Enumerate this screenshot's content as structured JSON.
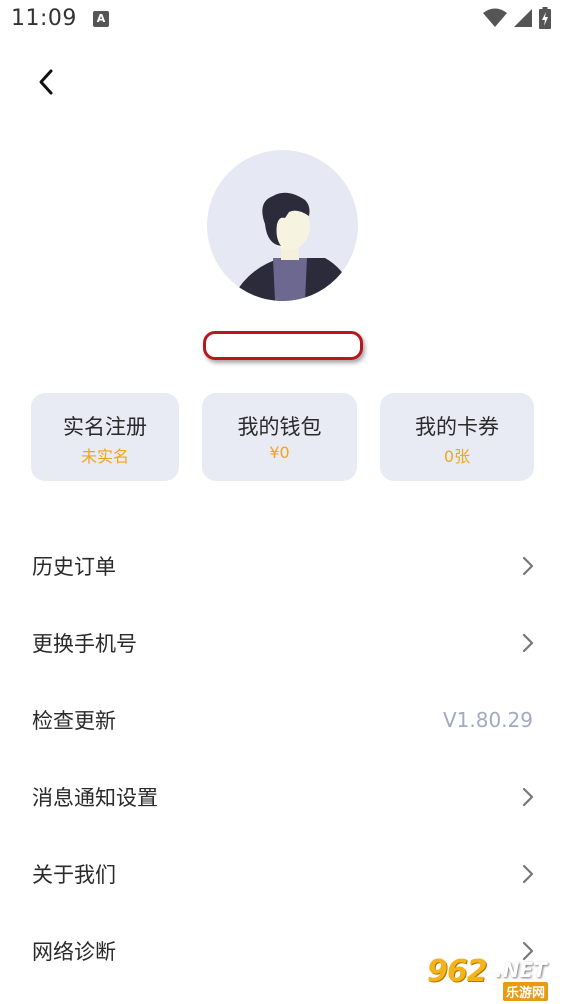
{
  "status_bar": {
    "time": "11:09",
    "notification_icon": "app-notification-icon",
    "icons": [
      "wifi-icon",
      "cell-signal-icon",
      "battery-charging-icon"
    ]
  },
  "header": {
    "back_icon": "chevron-left-icon"
  },
  "profile": {
    "avatar_icon": "user-avatar-icon",
    "username": ""
  },
  "stats": {
    "realname": {
      "title": "实名注册",
      "value": "未实名"
    },
    "wallet": {
      "title": "我的钱包",
      "value": "¥0"
    },
    "coupons": {
      "title": "我的卡券",
      "value": "0张"
    }
  },
  "menu": {
    "history_orders": "历史订单",
    "change_phone": "更换手机号",
    "check_update": "检查更新",
    "version": "V1.80.29",
    "notification_settings": "消息通知设置",
    "about_us": "关于我们",
    "network_diagnosis": "网络诊断"
  },
  "watermark": {
    "main": "962",
    "net": ".NET",
    "sub": "乐游网"
  },
  "colors": {
    "accent": "#f2a51b",
    "card_bg": "#e8ebf3",
    "muted": "#a2aac2",
    "highlight_border": "#b5181e"
  }
}
